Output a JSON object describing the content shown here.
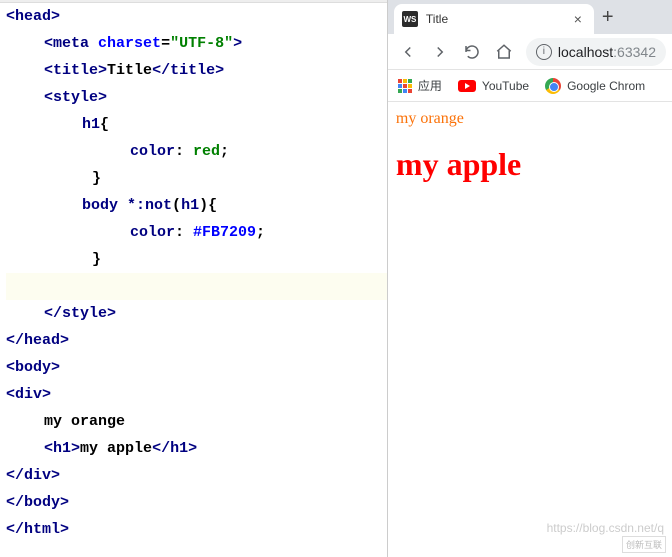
{
  "editor": {
    "code": {
      "head_open": "head",
      "meta": {
        "tag": "meta",
        "attr": "charset",
        "val": "UTF-8"
      },
      "title": {
        "tag": "title",
        "text": "Title"
      },
      "style_open": "style",
      "rule1": {
        "selector": "h1",
        "prop": "color",
        "val": "red"
      },
      "rule2": {
        "selector_pre": "body ",
        "star": "*",
        "not": ":not",
        "arg": "h1",
        "prop": "color",
        "val": "#FB7209"
      },
      "style_close": "style",
      "head_close": "head",
      "body_open": "body",
      "div_open": "div",
      "text1": "my orange",
      "h1": {
        "tag": "h1",
        "text": "my apple"
      },
      "div_close": "div",
      "body_close": "body",
      "html_close": "html"
    }
  },
  "browser": {
    "tab": {
      "favicon": "WS",
      "title": "Title"
    },
    "address": {
      "host": "localhost",
      "port": ":63342"
    },
    "bookmarks": {
      "apps": "应用",
      "youtube": "YouTube",
      "chrome": "Google Chrom"
    },
    "page": {
      "orange": "my orange",
      "apple": "my apple"
    },
    "watermark_url": "https://blog.csdn.net/q",
    "watermark_logo": "创新互联"
  }
}
